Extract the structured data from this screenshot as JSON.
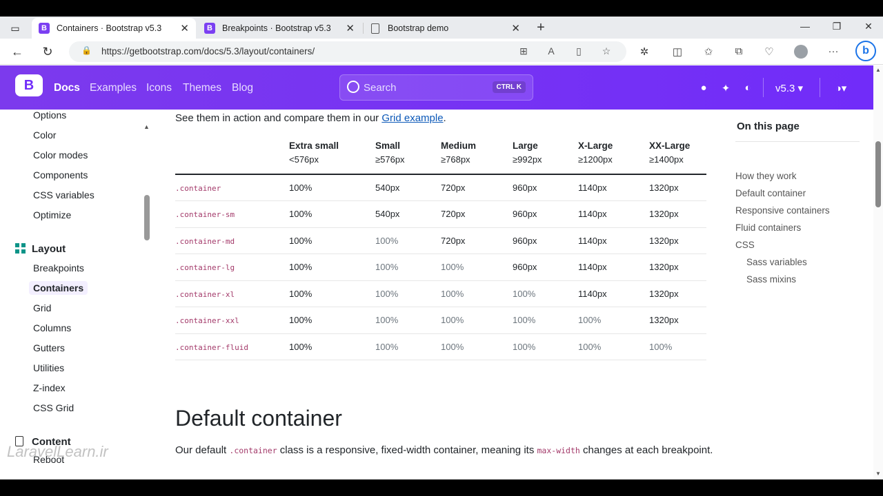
{
  "browser": {
    "tabs": [
      {
        "title": "Containers · Bootstrap v5.3",
        "favicon": "B"
      },
      {
        "title": "Breakpoints · Bootstrap v5.3",
        "favicon": "B"
      },
      {
        "title": "Bootstrap demo",
        "favicon": ""
      }
    ],
    "url": "https://getbootstrap.com/docs/5.3/layout/containers/",
    "profile_badge": "b"
  },
  "bs_nav": {
    "logo": "B",
    "links": [
      "Docs",
      "Examples",
      "Icons",
      "Themes",
      "Blog"
    ],
    "search_placeholder": "Search",
    "search_shortcut": "CTRL K",
    "version": "v5.3",
    "accent": "#712cf9"
  },
  "sidebar": {
    "items_top": [
      "Options",
      "Color",
      "Color modes",
      "Components",
      "CSS variables",
      "Optimize"
    ],
    "layout_heading": "Layout",
    "layout_items": [
      "Breakpoints",
      "Containers",
      "Grid",
      "Columns",
      "Gutters",
      "Utilities",
      "Z-index",
      "CSS Grid"
    ],
    "active_item": "Containers",
    "content_heading": "Content",
    "content_first": "Reboot",
    "watermark": "LaravelLearn.ir"
  },
  "main": {
    "intro_prefix": "See them in action and compare them in our ",
    "intro_link": "Grid example",
    "intro_suffix": ".",
    "table": {
      "headers": [
        {
          "name": "",
          "sub": ""
        },
        {
          "name": "Extra small",
          "sub": "<576px"
        },
        {
          "name": "Small",
          "sub": "≥576px"
        },
        {
          "name": "Medium",
          "sub": "≥768px"
        },
        {
          "name": "Large",
          "sub": "≥992px"
        },
        {
          "name": "X-Large",
          "sub": "≥1200px"
        },
        {
          "name": "XX-Large",
          "sub": "≥1400px"
        }
      ],
      "rows": [
        [
          ".container",
          "100%",
          "540px",
          "720px",
          "960px",
          "1140px",
          "1320px"
        ],
        [
          ".container-sm",
          "100%",
          "540px",
          "720px",
          "960px",
          "1140px",
          "1320px"
        ],
        [
          ".container-md",
          "100%",
          "100%",
          "720px",
          "960px",
          "1140px",
          "1320px"
        ],
        [
          ".container-lg",
          "100%",
          "100%",
          "100%",
          "960px",
          "1140px",
          "1320px"
        ],
        [
          ".container-xl",
          "100%",
          "100%",
          "100%",
          "100%",
          "1140px",
          "1320px"
        ],
        [
          ".container-xxl",
          "100%",
          "100%",
          "100%",
          "100%",
          "100%",
          "1320px"
        ],
        [
          ".container-fluid",
          "100%",
          "100%",
          "100%",
          "100%",
          "100%",
          "100%"
        ]
      ]
    },
    "heading": "Default container",
    "para_1": "Our default ",
    "para_code_1": ".container",
    "para_2": " class is a responsive, fixed-width container, meaning its ",
    "para_code_2": "max-width",
    "para_3": " changes at each breakpoint."
  },
  "toc": {
    "title": "On this page",
    "items": [
      "How they work",
      "Default container",
      "Responsive containers",
      "Fluid containers",
      "CSS"
    ],
    "sub_items": [
      "Sass variables",
      "Sass mixins"
    ]
  }
}
